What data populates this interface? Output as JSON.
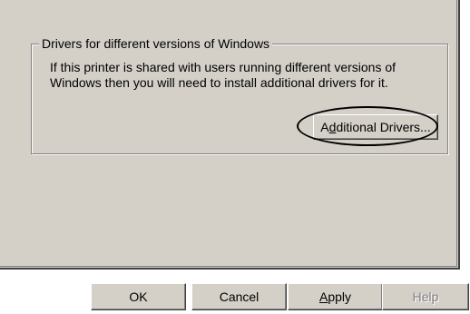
{
  "group": {
    "legend": "Drivers for different versions of Windows",
    "line1": "If this printer is shared with users running different versions of",
    "line2": "Windows then you will need to install additional drivers for it."
  },
  "additional_drivers": {
    "pre": "A",
    "accel": "d",
    "post": "ditional Drivers..."
  },
  "footer": {
    "ok": "OK",
    "cancel": "Cancel",
    "apply_accel": "A",
    "apply_rest": "pply",
    "help": "Help"
  }
}
